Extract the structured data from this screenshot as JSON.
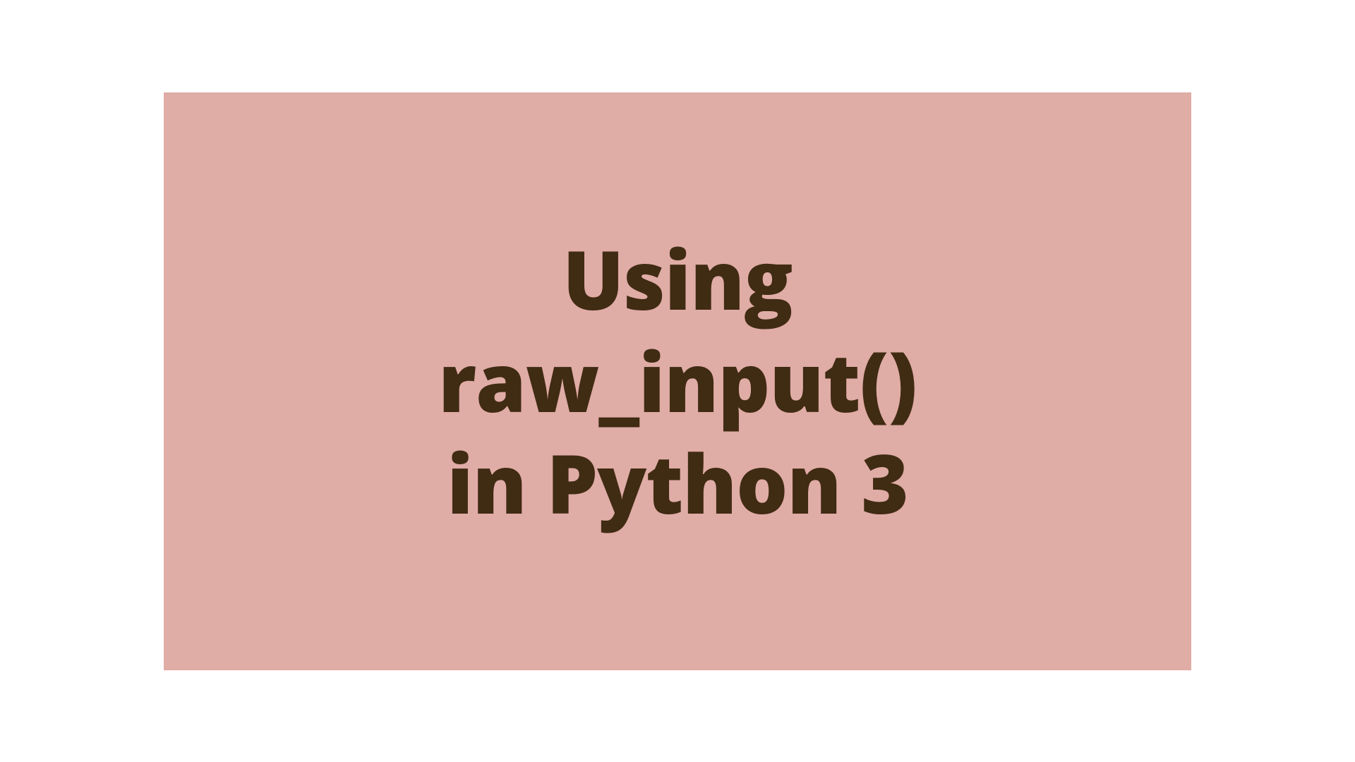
{
  "title": {
    "line1": "Using",
    "line2": "raw_input()",
    "line3": "in Python 3"
  },
  "colors": {
    "card_bg": "#e0aca6",
    "text": "#402b13"
  }
}
